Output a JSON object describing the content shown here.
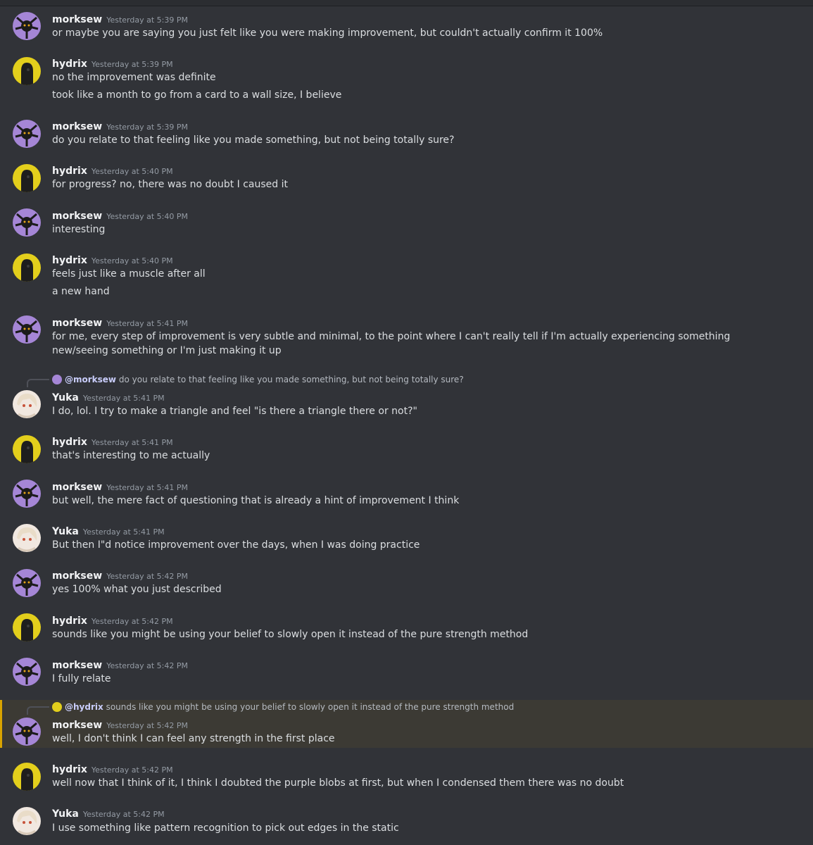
{
  "users": {
    "morksew": {
      "name": "morksew",
      "avatar_color": "#a586d6"
    },
    "hydrix": {
      "name": "hydrix",
      "avatar_color": "#e3cf1c"
    },
    "yuka": {
      "name": "Yuka",
      "avatar_color": "#f1e8e0"
    }
  },
  "messages": [
    {
      "author": "morksew",
      "time": "Yesterday at 5:39 PM",
      "lines": [
        "or maybe you are saying you just felt like you were making improvement, but couldn't actually confirm it 100%"
      ]
    },
    {
      "author": "hydrix",
      "time": "Yesterday at 5:39 PM",
      "lines": [
        "no the improvement was definite",
        "took like a month to go from a card to a wall size, I believe"
      ]
    },
    {
      "author": "morksew",
      "time": "Yesterday at 5:39 PM",
      "lines": [
        "do you relate to that feeling like you made something, but not being totally sure?"
      ]
    },
    {
      "author": "hydrix",
      "time": "Yesterday at 5:40 PM",
      "lines": [
        "for progress? no, there was no doubt I caused it"
      ]
    },
    {
      "author": "morksew",
      "time": "Yesterday at 5:40 PM",
      "lines": [
        "interesting"
      ]
    },
    {
      "author": "hydrix",
      "time": "Yesterday at 5:40 PM",
      "lines": [
        "feels just like a muscle after all",
        "a new hand"
      ]
    },
    {
      "author": "morksew",
      "time": "Yesterday at 5:41 PM",
      "lines": [
        "for me, every step of improvement is very subtle and minimal, to the point where I can't really tell if I'm actually experiencing something new/seeing something or I'm just making it up"
      ]
    },
    {
      "author": "Yuka",
      "time": "Yesterday at 5:41 PM",
      "reply": {
        "mention": "@morksew",
        "text": "do you relate to that feeling like you made something, but not being totally sure?"
      },
      "lines": [
        "I do, lol. I try to make a triangle and feel \"is there a triangle there or not?\""
      ]
    },
    {
      "author": "hydrix",
      "time": "Yesterday at 5:41 PM",
      "lines": [
        "that's interesting to me actually"
      ]
    },
    {
      "author": "morksew",
      "time": "Yesterday at 5:41 PM",
      "lines": [
        "but well, the mere fact of questioning that is already a hint of improvement I think"
      ]
    },
    {
      "author": "Yuka",
      "time": "Yesterday at 5:41 PM",
      "lines": [
        "But then I\"d notice improvement over the days, when I was doing practice"
      ]
    },
    {
      "author": "morksew",
      "time": "Yesterday at 5:42 PM",
      "lines": [
        "yes 100% what you just described"
      ]
    },
    {
      "author": "hydrix",
      "time": "Yesterday at 5:42 PM",
      "lines": [
        "sounds like you might be using your belief to slowly open it instead of the pure strength method"
      ]
    },
    {
      "author": "morksew",
      "time": "Yesterday at 5:42 PM",
      "lines": [
        "I fully relate"
      ]
    },
    {
      "author": "morksew",
      "time": "Yesterday at 5:42 PM",
      "reply": {
        "mention": "@hydrix",
        "text": "sounds like you might be using your belief to slowly open it instead of the pure strength method"
      },
      "lines": [
        "well, I don't think I can feel any strength in the first place"
      ]
    },
    {
      "author": "hydrix",
      "time": "Yesterday at 5:42 PM",
      "lines": [
        "well now that I think of it, I think I doubted the purple blobs at first, but when I condensed them there was no doubt"
      ]
    },
    {
      "author": "Yuka",
      "time": "Yesterday at 5:42 PM",
      "lines": [
        "I use something like pattern recognition to pick out edges in the static"
      ]
    }
  ]
}
